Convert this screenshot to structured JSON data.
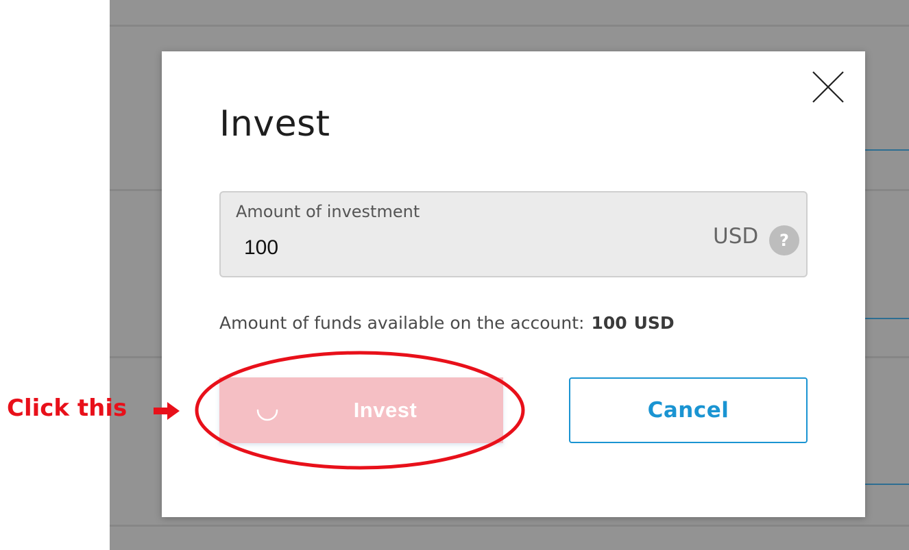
{
  "modal": {
    "title": "Invest",
    "amount_field": {
      "label": "Amount of investment",
      "value": "100",
      "currency": "USD",
      "help_glyph": "?"
    },
    "available_funds": {
      "label": "Amount of funds available on the account:",
      "value": "100",
      "currency": "USD"
    },
    "invest_button": {
      "label": "Invest",
      "state": "loading"
    },
    "cancel_button": {
      "label": "Cancel"
    }
  },
  "annotation": {
    "text": "Click this",
    "icons": [
      "arrow-right-icon",
      "highlight-ellipse"
    ]
  },
  "colors": {
    "accent_blue": "#1a94d2",
    "invest_button_disabled": "#f5bfc4",
    "annotation_red": "#e8101a",
    "backdrop": "#939393"
  },
  "icons": {
    "close": "close-icon",
    "help": "question-circle-icon",
    "spinner": "loading-spinner-icon"
  }
}
